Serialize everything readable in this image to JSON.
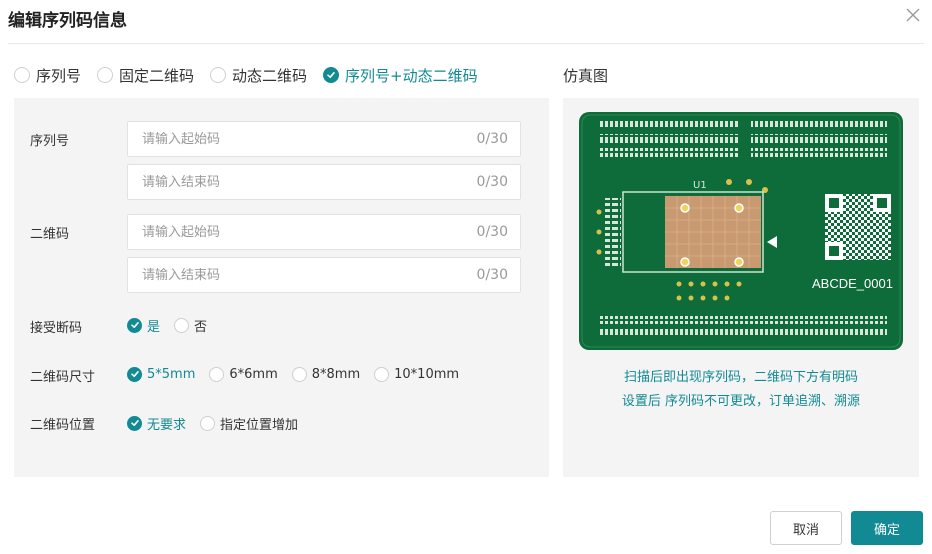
{
  "dialog": {
    "title": "编辑序列码信息"
  },
  "modes": [
    {
      "label": "序列号",
      "selected": false
    },
    {
      "label": "固定二维码",
      "selected": false
    },
    {
      "label": "动态二维码",
      "selected": false
    },
    {
      "label": "序列号+动态二维码",
      "selected": true
    }
  ],
  "form": {
    "serial": {
      "label": "序列号",
      "start": {
        "placeholder": "请输入起始码",
        "value": "",
        "counter": "0/30"
      },
      "end": {
        "placeholder": "请输入结束码",
        "value": "",
        "counter": "0/30"
      }
    },
    "qr": {
      "label": "二维码",
      "start": {
        "placeholder": "请输入起始码",
        "value": "",
        "counter": "0/30"
      },
      "end": {
        "placeholder": "请输入结束码",
        "value": "",
        "counter": "0/30"
      }
    },
    "accept_break": {
      "label": "接受断码",
      "options": [
        {
          "label": "是",
          "selected": true
        },
        {
          "label": "否",
          "selected": false
        }
      ]
    },
    "qr_size": {
      "label": "二维码尺寸",
      "options": [
        {
          "label": "5*5mm",
          "selected": true
        },
        {
          "label": "6*6mm",
          "selected": false
        },
        {
          "label": "8*8mm",
          "selected": false
        },
        {
          "label": "10*10mm",
          "selected": false
        }
      ]
    },
    "qr_position": {
      "label": "二维码位置",
      "options": [
        {
          "label": "无要求",
          "selected": true
        },
        {
          "label": "指定位置增加",
          "selected": false
        }
      ]
    }
  },
  "preview": {
    "title": "仿真图",
    "board_text": "ABCDE_0001",
    "chip_label": "U1",
    "note_line1": "扫描后即出现序列码，二维码下方有明码",
    "note_line2": "设置后 序列码不可更改，订单追溯、溯源"
  },
  "footer": {
    "cancel_label": "取消",
    "ok_label": "确定"
  },
  "colors": {
    "accent": "#128a93",
    "pcb_green": "#0e6b3a",
    "panel_bg": "#f4f4f4"
  }
}
